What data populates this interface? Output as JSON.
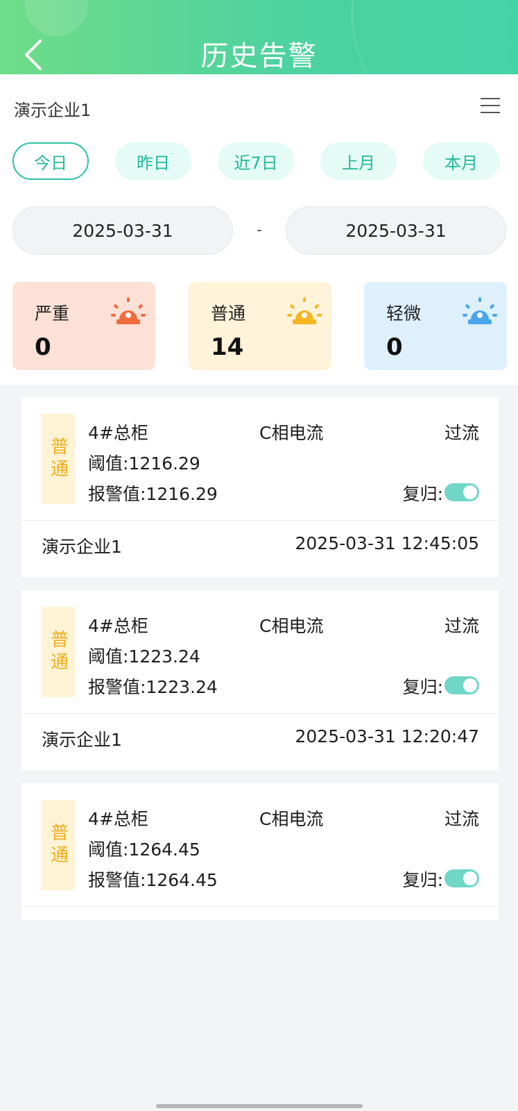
{
  "header": {
    "title": "历史告警"
  },
  "company_selector": {
    "name": "演示企业1"
  },
  "date_chips": [
    {
      "label": "今日",
      "active": true
    },
    {
      "label": "昨日",
      "active": false
    },
    {
      "label": "近7日",
      "active": false
    },
    {
      "label": "上月",
      "active": false
    },
    {
      "label": "本月",
      "active": false
    }
  ],
  "date_range": {
    "start": "2025-03-31",
    "separator": "-",
    "end": "2025-03-31"
  },
  "stats": [
    {
      "label": "严重",
      "count": "0",
      "color": "#f26b3a"
    },
    {
      "label": "普通",
      "count": "14",
      "color": "#f5b623"
    },
    {
      "label": "轻微",
      "count": "0",
      "color": "#4aa6ec"
    }
  ],
  "alarms": [
    {
      "level": "普通",
      "device": "4#总柜",
      "phase": "C相电流",
      "type": "过流",
      "threshold": "阈值:1216.29",
      "alarm_value": "报警值:1216.29",
      "reset_label": "复归:",
      "reset_on": true,
      "company": "演示企业1",
      "time": "2025-03-31 12:45:05"
    },
    {
      "level": "普通",
      "device": "4#总柜",
      "phase": "C相电流",
      "type": "过流",
      "threshold": "阈值:1223.24",
      "alarm_value": "报警值:1223.24",
      "reset_label": "复归:",
      "reset_on": true,
      "company": "演示企业1",
      "time": "2025-03-31 12:20:47"
    },
    {
      "level": "普通",
      "device": "4#总柜",
      "phase": "C相电流",
      "type": "过流",
      "threshold": "阈值:1264.45",
      "alarm_value": "报警值:1264.45",
      "reset_label": "复归:",
      "reset_on": true
    }
  ],
  "colors": {
    "accent": "#2cc3a4",
    "header_start": "#6fdc88",
    "header_end": "#45d3a6"
  }
}
